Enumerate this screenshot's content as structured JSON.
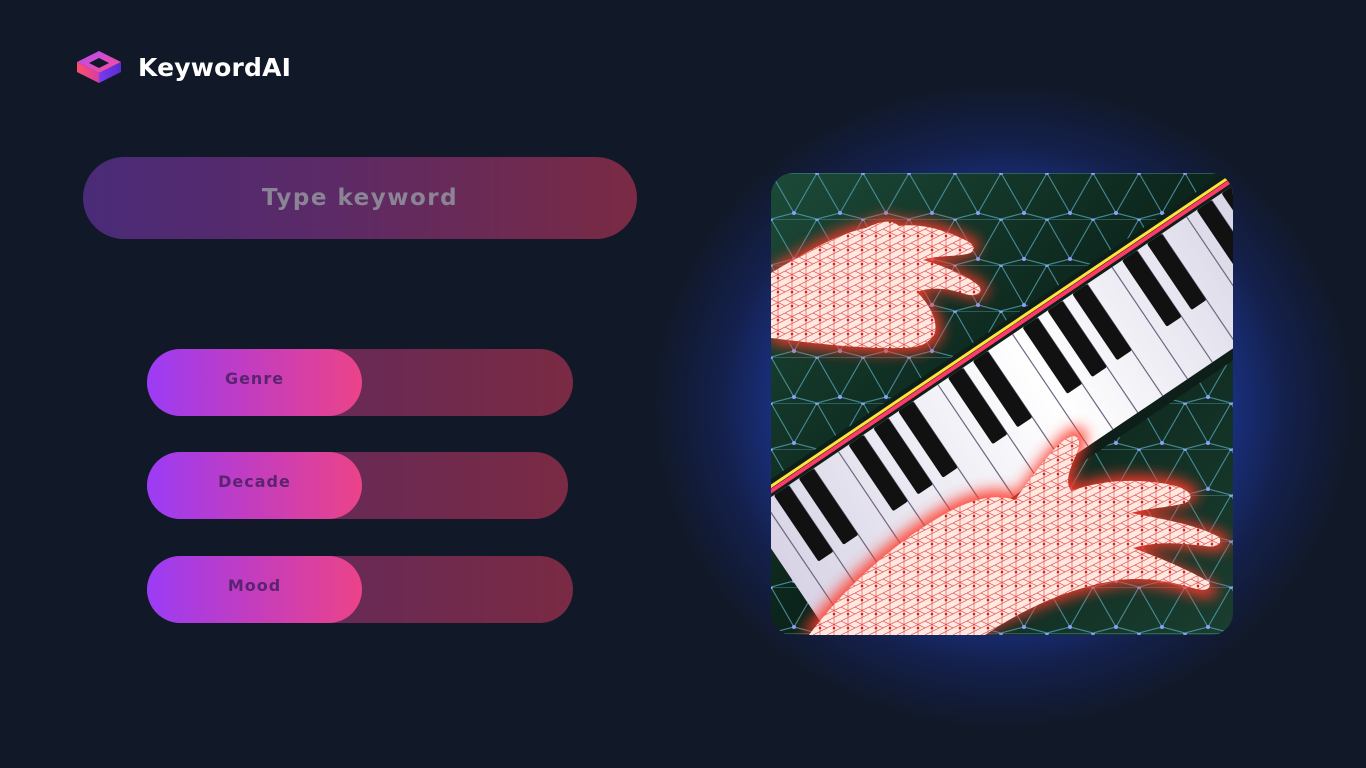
{
  "app": {
    "name": "KeywordAI",
    "logo_icon": "isometric-cube-logo-icon"
  },
  "search": {
    "placeholder": "Type keyword",
    "value": ""
  },
  "filters": [
    {
      "label": "Genre"
    },
    {
      "label": "Decade"
    },
    {
      "label": "Mood"
    }
  ],
  "artwork": {
    "subject": "hands playing piano, neon mesh illustration"
  },
  "colors": {
    "background": "#111827",
    "accent_purple": "#9b3cf5",
    "accent_pink": "#ec4389",
    "glow_blue": "#2e5cff"
  }
}
